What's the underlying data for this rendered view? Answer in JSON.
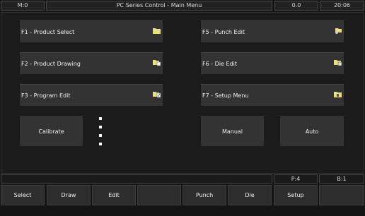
{
  "title_bar": {
    "mode": "M:0",
    "title": "PC Series Control - Main Menu",
    "value": "0.0",
    "time": "20:06"
  },
  "menu": {
    "f1": {
      "label": "F1 - Product Select",
      "icon": "folder-icon"
    },
    "f2": {
      "label": "F2 - Product Drawing",
      "icon": "drawing-file-icon"
    },
    "f3": {
      "label": "F3 - Program Edit",
      "icon": "edit-file-icon"
    },
    "f5": {
      "label": "F5 - Punch Edit",
      "icon": "punch-file-icon"
    },
    "f6": {
      "label": "F6 - Die Edit",
      "icon": "die-file-icon"
    },
    "f7": {
      "label": "F7 - Setup Menu",
      "icon": "setup-folder-icon"
    },
    "calibrate": "Calibrate",
    "manual": "Manual",
    "auto": "Auto"
  },
  "status_bar": {
    "p": "P:4",
    "b": "B:1"
  },
  "softkeys": [
    "Select",
    "Draw",
    "Edit",
    "",
    "Punch",
    "Die",
    "Setup",
    ""
  ],
  "colors": {
    "background": "#141414",
    "button": "#333333",
    "folder_icon": "#e8e07a"
  }
}
